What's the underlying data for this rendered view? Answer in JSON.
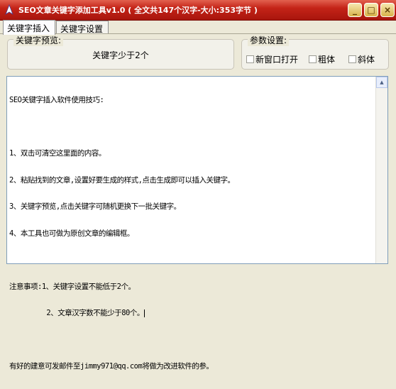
{
  "window": {
    "title": "SEO文章关键字添加工具v1.0 ( 全文共147个汉字-大小:353字节 )",
    "controls": {
      "minimize": "_",
      "maximize": "□",
      "close": "×"
    },
    "accent": "#c42418"
  },
  "tabs": [
    {
      "label": "关键字插入",
      "active": true
    },
    {
      "label": "关键字设置",
      "active": false
    }
  ],
  "preview": {
    "group_label": "关键字预览:",
    "value": "关键字少于2个"
  },
  "params": {
    "group_label": "参数设置:",
    "options": [
      {
        "label": "新窗口打开",
        "checked": false
      },
      {
        "label": "粗体",
        "checked": false
      },
      {
        "label": "斜体",
        "checked": false
      }
    ]
  },
  "editor": {
    "lines": [
      "SEO关键字插入软件使用技巧:",
      "",
      "1、双击可清空这里面的内容。",
      "2、粘贴找到的文章,设置好要生成的样式,点击生成即可以插入关键字。",
      "3、关键字预览,点击关键字可随机更换下一批关键字。",
      "4、本工具也可做为原创文章的编辑框。",
      "",
      "注意事项:1、关键字设置不能低于2个。",
      "         2、文章汉字数不能少于80个。",
      "",
      "有好的建意可发邮件至jimmy971@qq.com将做为改进软件的参。"
    ]
  }
}
